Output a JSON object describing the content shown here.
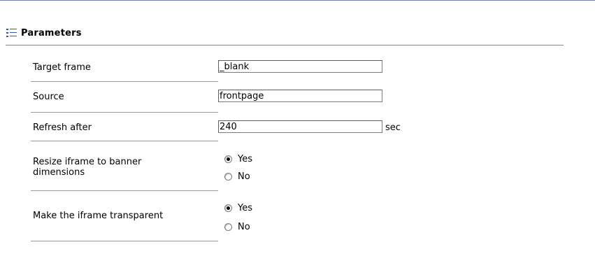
{
  "section": {
    "title": "Parameters",
    "icon": "list-icon"
  },
  "fields": {
    "target_frame": {
      "label": "Target frame",
      "value": "_blank"
    },
    "source": {
      "label": "Source",
      "value": "frontpage"
    },
    "refresh": {
      "label": "Refresh after",
      "value": "240",
      "unit": "sec"
    },
    "resize": {
      "label": "Resize iframe to banner dimensions",
      "options": [
        "Yes",
        "No"
      ],
      "selected": "Yes"
    },
    "transparent": {
      "label": "Make the iframe transparent",
      "options": [
        "Yes",
        "No"
      ],
      "selected": "Yes"
    }
  },
  "colors": {
    "top_rule": "#6f83b8",
    "icon_blue": "#2d55c8"
  }
}
